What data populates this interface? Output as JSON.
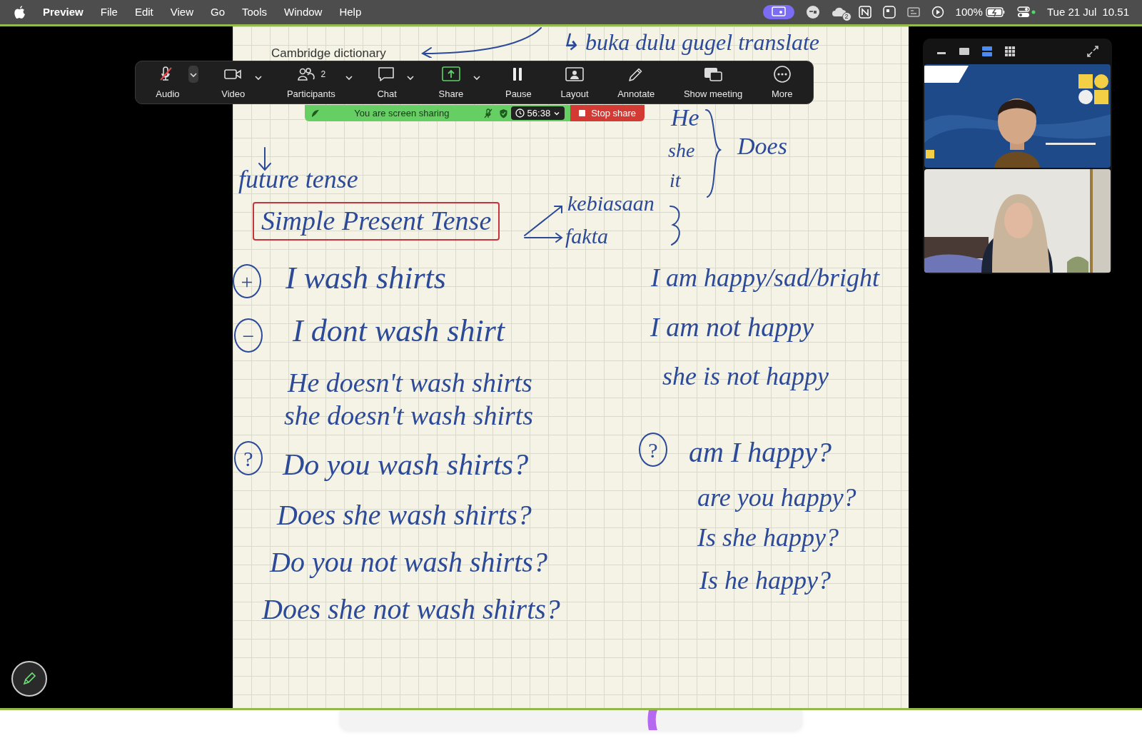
{
  "menu_bar": {
    "app": "Preview",
    "items": [
      "File",
      "Edit",
      "View",
      "Go",
      "Tools",
      "Window",
      "Help"
    ],
    "status": {
      "notification_badge": "2",
      "battery": "100%",
      "date": "Tue 21 Jul",
      "time": "10.51"
    }
  },
  "meeting_toolbar": {
    "buttons": [
      {
        "label": "Audio",
        "kind": "mic",
        "muted": true,
        "caret": true
      },
      {
        "label": "Video",
        "kind": "camera",
        "caret": true
      },
      {
        "label": "Participants",
        "kind": "people",
        "count": "2",
        "caret": true
      },
      {
        "label": "Chat",
        "kind": "chat",
        "caret": true
      },
      {
        "label": "Share",
        "kind": "share",
        "caret": true
      },
      {
        "label": "Pause",
        "kind": "pause",
        "caret": false
      },
      {
        "label": "Layout",
        "kind": "layout",
        "caret": false
      },
      {
        "label": "Annotate",
        "kind": "pencil",
        "caret": false
      },
      {
        "label": "Show meeting",
        "kind": "windows",
        "caret": false
      },
      {
        "label": "More",
        "kind": "more",
        "caret": false
      }
    ]
  },
  "share_bar": {
    "message": "You are screen sharing",
    "timer": "56:38",
    "stop_label": "Stop share"
  },
  "notes": [
    {
      "text": "Cambridge dictionary",
      "kind": "printed"
    },
    {
      "text": "↳ buka dulu gugel translate",
      "kind": "line"
    },
    {
      "text": "future tense",
      "kind": "line"
    },
    {
      "text": "Simple Present Tense",
      "kind": "boxed"
    },
    {
      "text": "kebiasaan",
      "kind": "line"
    },
    {
      "text": "fakta",
      "kind": "line"
    },
    {
      "text": "He",
      "kind": "line"
    },
    {
      "text": "she",
      "kind": "line"
    },
    {
      "text": "it",
      "kind": "line"
    },
    {
      "text": "Does",
      "kind": "line"
    },
    {
      "text": "+",
      "kind": "circled"
    },
    {
      "text": "I wash shirts",
      "kind": "line"
    },
    {
      "text": "−",
      "kind": "circled"
    },
    {
      "text": "I dont wash shirt",
      "kind": "line"
    },
    {
      "text": "He doesn't wash shirts",
      "kind": "line"
    },
    {
      "text": "she doesn't wash shirts",
      "kind": "line"
    },
    {
      "text": "?",
      "kind": "circled"
    },
    {
      "text": "Do you wash shirts?",
      "kind": "line"
    },
    {
      "text": "Does she wash shirts?",
      "kind": "line"
    },
    {
      "text": "Do you not wash shirts?",
      "kind": "line"
    },
    {
      "text": "Does she not wash shirts?",
      "kind": "line"
    },
    {
      "text": "I am happy/sad/bright",
      "kind": "line"
    },
    {
      "text": "I am not happy",
      "kind": "line"
    },
    {
      "text": "she is not happy",
      "kind": "line"
    },
    {
      "text": "?",
      "kind": "circled"
    },
    {
      "text": "am I happy?",
      "kind": "line"
    },
    {
      "text": "are you happy?",
      "kind": "line"
    },
    {
      "text": "Is she happy?",
      "kind": "line"
    },
    {
      "text": "Is he happy?",
      "kind": "line"
    }
  ],
  "video_panel": {
    "view_modes": [
      {
        "kind": "minimize",
        "selected": false
      },
      {
        "kind": "single",
        "selected": false
      },
      {
        "kind": "stacked",
        "selected": true
      },
      {
        "kind": "grid",
        "selected": false
      }
    ]
  }
}
